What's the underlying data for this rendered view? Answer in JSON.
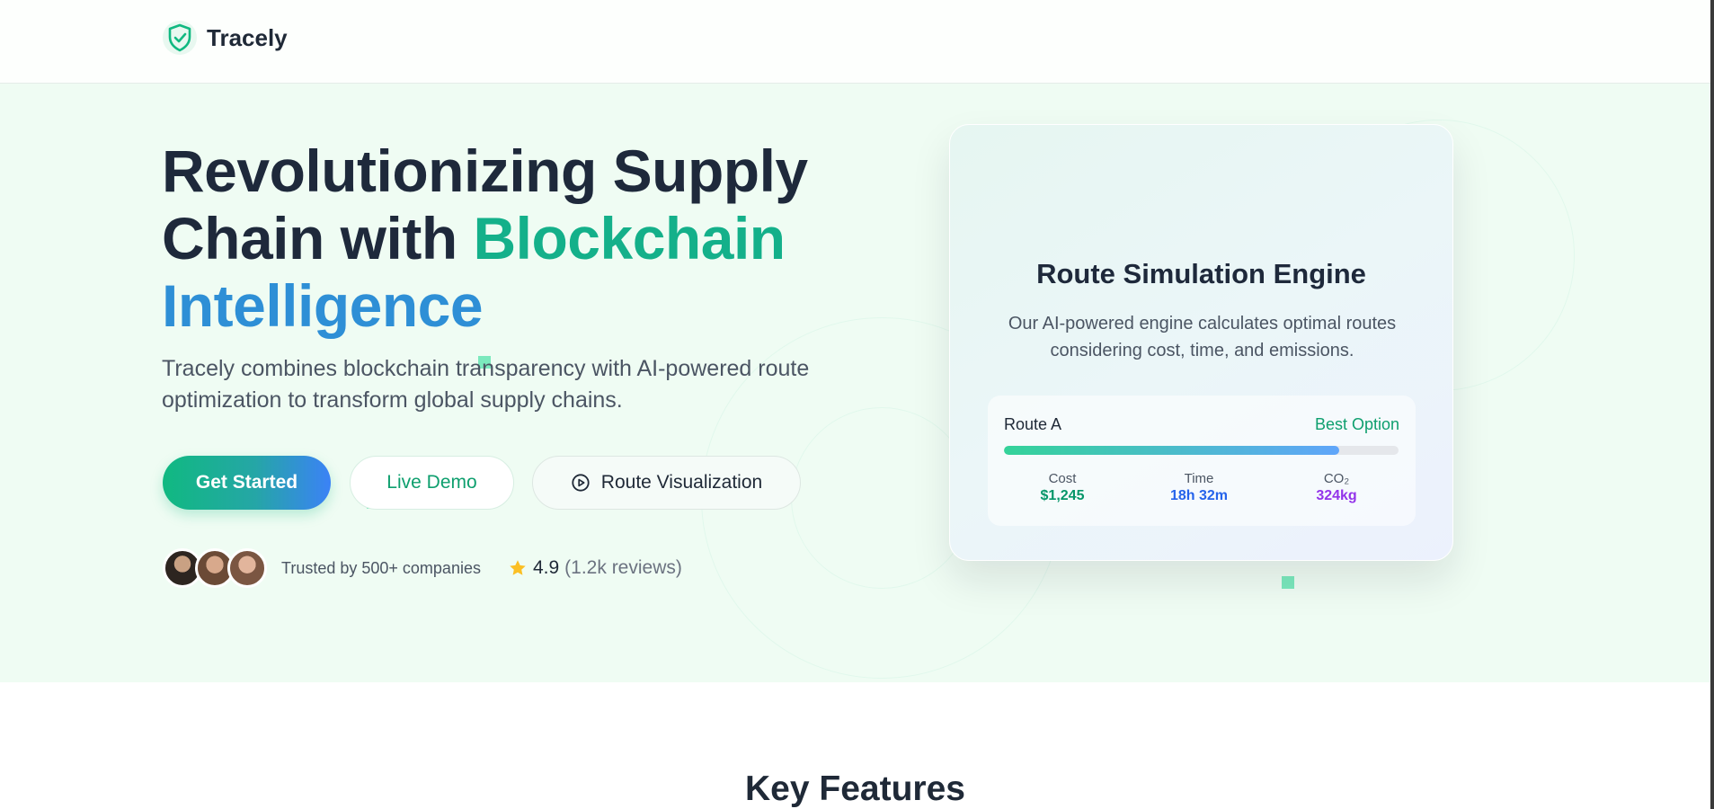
{
  "brand": {
    "name": "Tracely"
  },
  "hero": {
    "headline_part1": "Revolutionizing Supply Chain with ",
    "headline_green": "Blockchain",
    "headline_blue": "Intelligence",
    "subtitle": "Tracely combines blockchain transparency with AI-powered route optimization to transform global supply chains.",
    "buttons": {
      "get_started": "Get Started",
      "live_demo": "Live Demo",
      "route_visualization": "Route Visualization"
    },
    "trust_text": "Trusted by 500+ companies",
    "rating": {
      "value": "4.9",
      "count": "(1.2k reviews)"
    }
  },
  "card": {
    "title": "Route Simulation Engine",
    "description": "Our AI-powered engine calculates optimal routes considering cost, time, and emissions.",
    "route": {
      "name": "Route A",
      "badge": "Best Option",
      "progress": 0.85,
      "stats": {
        "cost": {
          "label": "Cost",
          "value": "$1,245"
        },
        "time": {
          "label": "Time",
          "value": "18h 32m"
        },
        "co2": {
          "label": "CO₂",
          "value": "324kg"
        }
      }
    }
  },
  "features": {
    "title": "Key Features"
  },
  "icons": {
    "logo": "shield-check-icon",
    "route_visualization": "play-circle-icon",
    "rating": "star-icon"
  },
  "colors": {
    "brand_green": "#10b981",
    "brand_blue": "#3b82f6",
    "hero_bg": "#effcf3",
    "star": "#fbbf24"
  }
}
